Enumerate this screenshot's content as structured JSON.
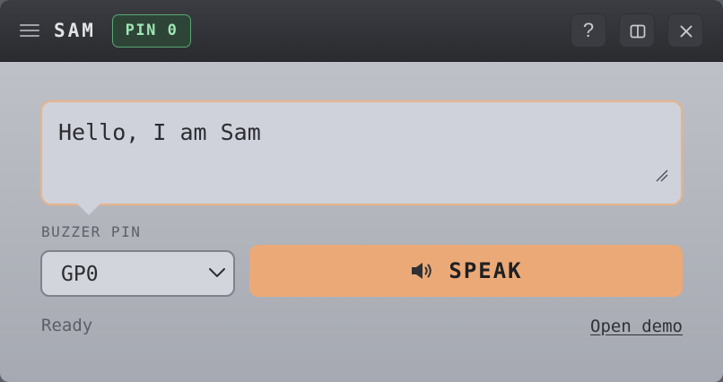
{
  "header": {
    "title": "SAM",
    "pin_badge": "PIN 0",
    "buttons": {
      "menu_icon": "menu-icon",
      "help_label": "?",
      "help_icon": "help-icon",
      "split_icon": "split-view-icon",
      "close_icon": "close-icon"
    }
  },
  "speech": {
    "text": "Hello, I am Sam"
  },
  "controls": {
    "pin_label": "BUZZER PIN",
    "pin_selected": "GP0",
    "speak_label": "SPEAK",
    "speak_icon": "speaker-icon"
  },
  "footer": {
    "status": "Ready",
    "demo_link": "Open demo"
  },
  "colors": {
    "titlebar": "#2a2b2f",
    "badge_border": "#5aa874",
    "badge_text": "#9ee6b2",
    "textarea_border": "#e6b48d",
    "speak_button": "#eba977",
    "panel_background": "#b8bbc2"
  }
}
